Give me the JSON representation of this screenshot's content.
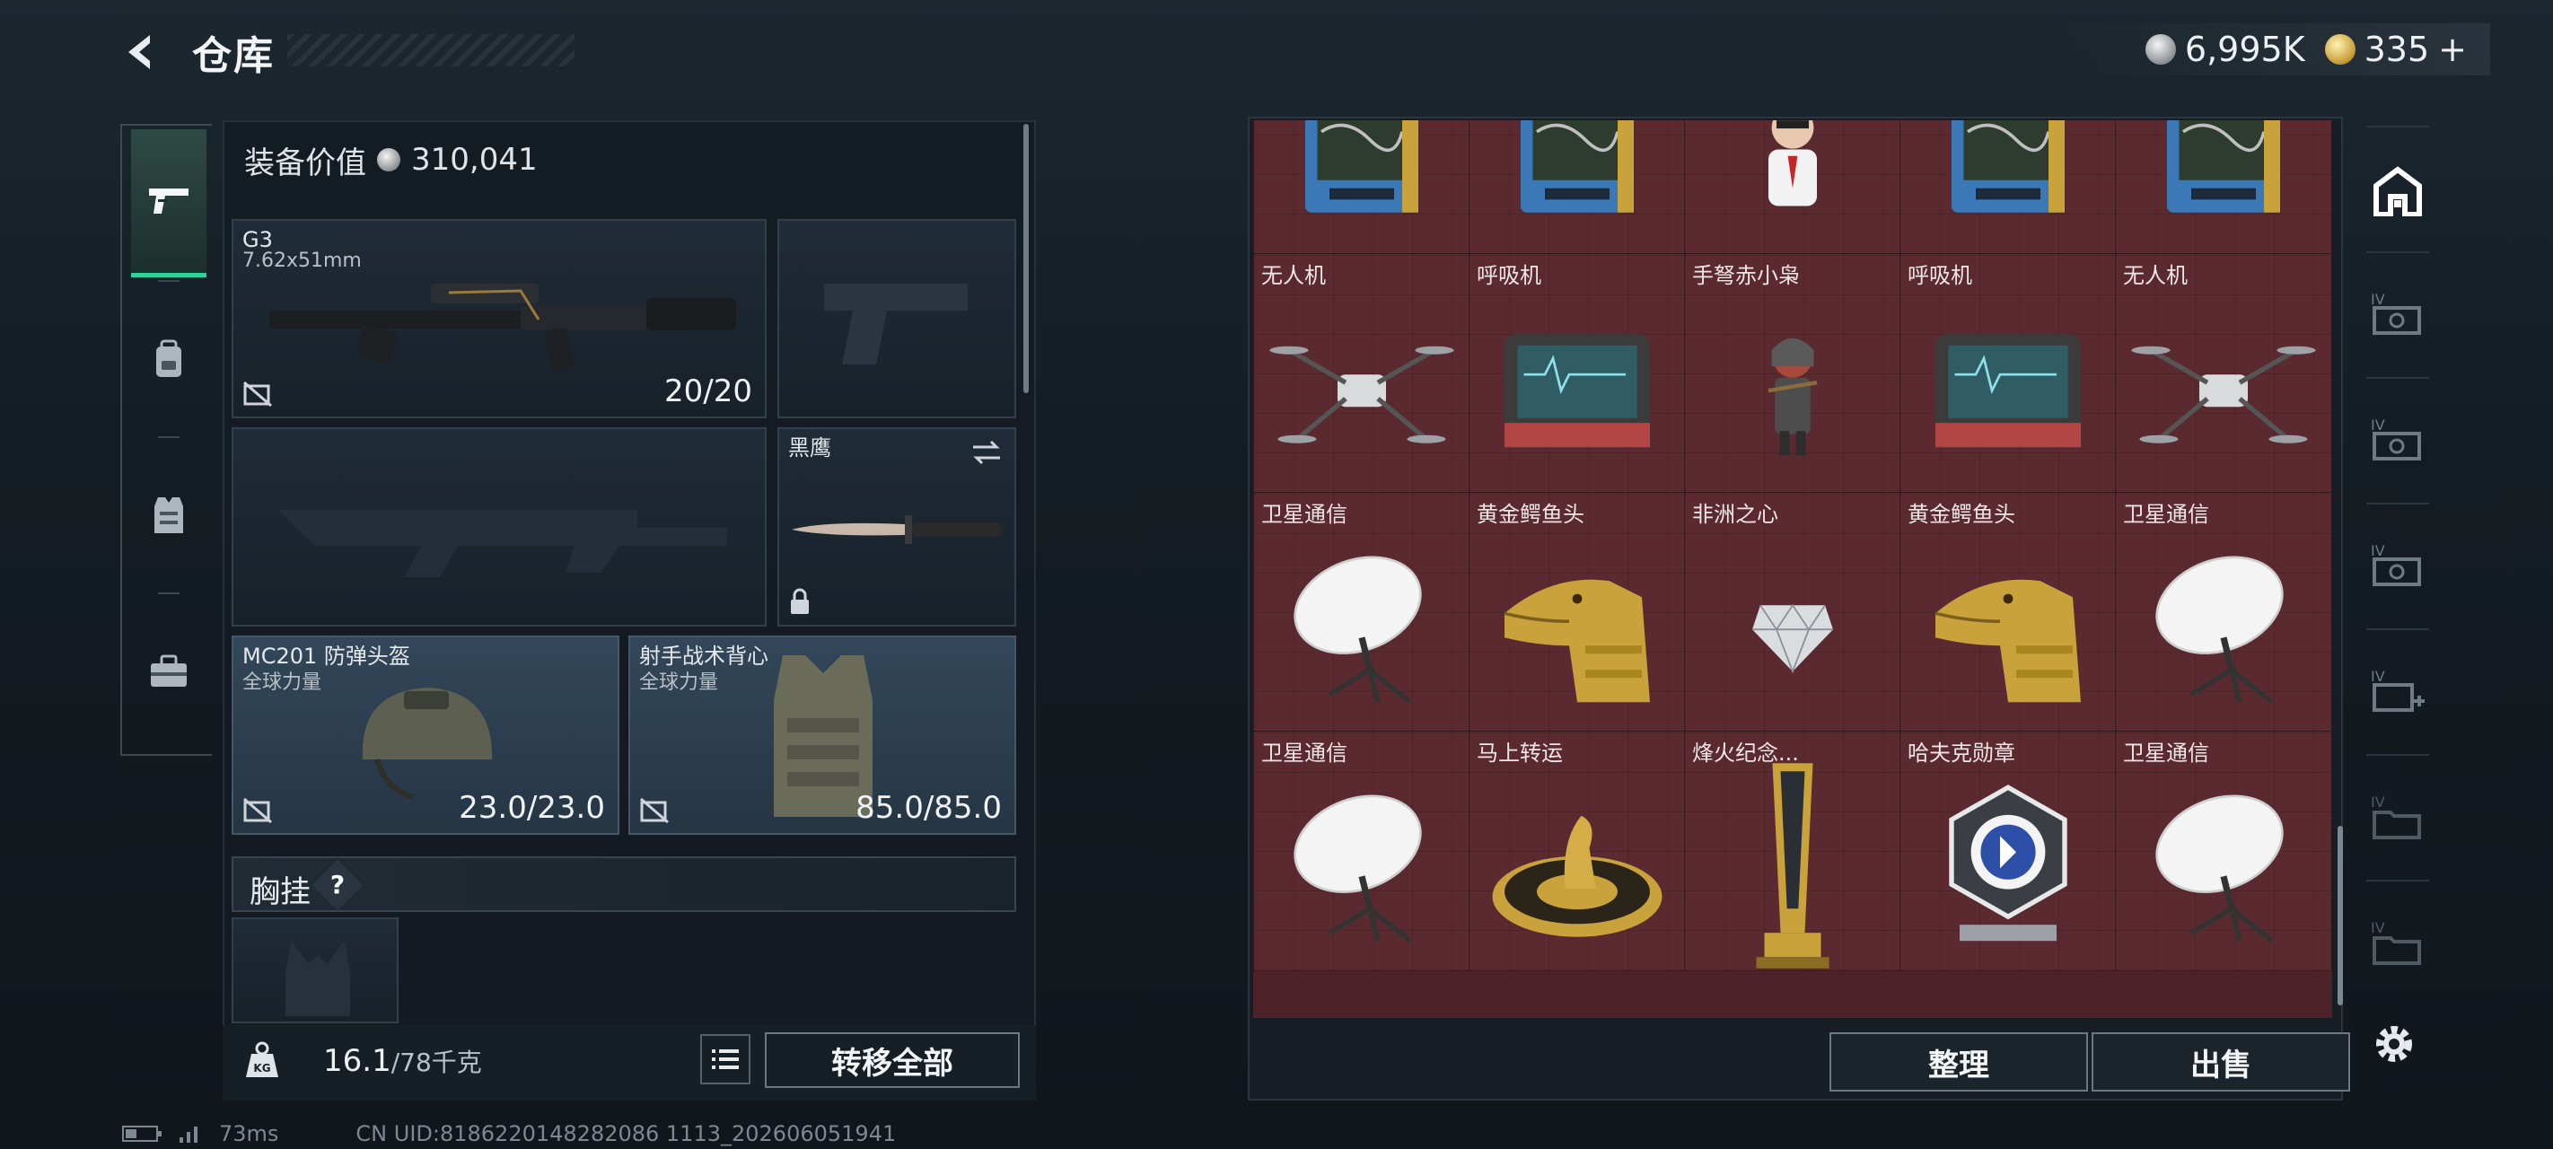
{
  "header": {
    "title": "仓库",
    "currency_silver": "6,995K",
    "currency_gold": "335",
    "currency_gold_suffix": "+"
  },
  "left_tabs": [
    "weapon",
    "backpack",
    "vest",
    "toolbox"
  ],
  "equipment": {
    "value_label": "装备价值",
    "value": "310,041",
    "primary": {
      "name": "G3",
      "caliber": "7.62x51mm",
      "ammo": "20/20"
    },
    "melee": {
      "name": "黑鹰"
    },
    "helmet": {
      "name": "MC201 防弹头盔",
      "faction": "全球力量",
      "durability": "23.0/23.0"
    },
    "armor": {
      "name": "射手战术背心",
      "faction": "全球力量",
      "durability": "85.0/85.0"
    },
    "chest_rig": {
      "label": "胸挂",
      "help": "?"
    }
  },
  "bottom_left": {
    "weight": "16.1",
    "weight_max": "/78千克",
    "transfer_label": "转移全部"
  },
  "grid_items": [
    {
      "label": "",
      "icon": "equipment-box"
    },
    {
      "label": "",
      "icon": "equipment-box"
    },
    {
      "label": "",
      "icon": "colonel-figurine"
    },
    {
      "label": "",
      "icon": "equipment-box"
    },
    {
      "label": "",
      "icon": "equipment-box"
    },
    {
      "label": "无人机",
      "icon": "drone"
    },
    {
      "label": "呼吸机",
      "icon": "ventilator"
    },
    {
      "label": "手弩赤小枭",
      "icon": "figurine"
    },
    {
      "label": "呼吸机",
      "icon": "ventilator"
    },
    {
      "label": "无人机",
      "icon": "drone"
    },
    {
      "label": "卫星通信",
      "icon": "satellite-dish"
    },
    {
      "label": "黄金鳄鱼头",
      "icon": "golden-croc-head"
    },
    {
      "label": "非洲之心",
      "icon": "diamond"
    },
    {
      "label": "黄金鳄鱼头",
      "icon": "golden-croc-head"
    },
    {
      "label": "卫星通信",
      "icon": "satellite-dish"
    },
    {
      "label": "卫星通信",
      "icon": "satellite-dish"
    },
    {
      "label": "马上转运",
      "icon": "horse-coin"
    },
    {
      "label": "烽火纪念...",
      "icon": "trophy"
    },
    {
      "label": "哈夫克勋章",
      "icon": "medal"
    },
    {
      "label": "卫星通信",
      "icon": "satellite-dish"
    }
  ],
  "actions": {
    "sort_label": "整理",
    "sell_label": "出售"
  },
  "status": {
    "ping": "73ms",
    "uid": "CN UID:8186220148282086 1113_202606051941"
  }
}
